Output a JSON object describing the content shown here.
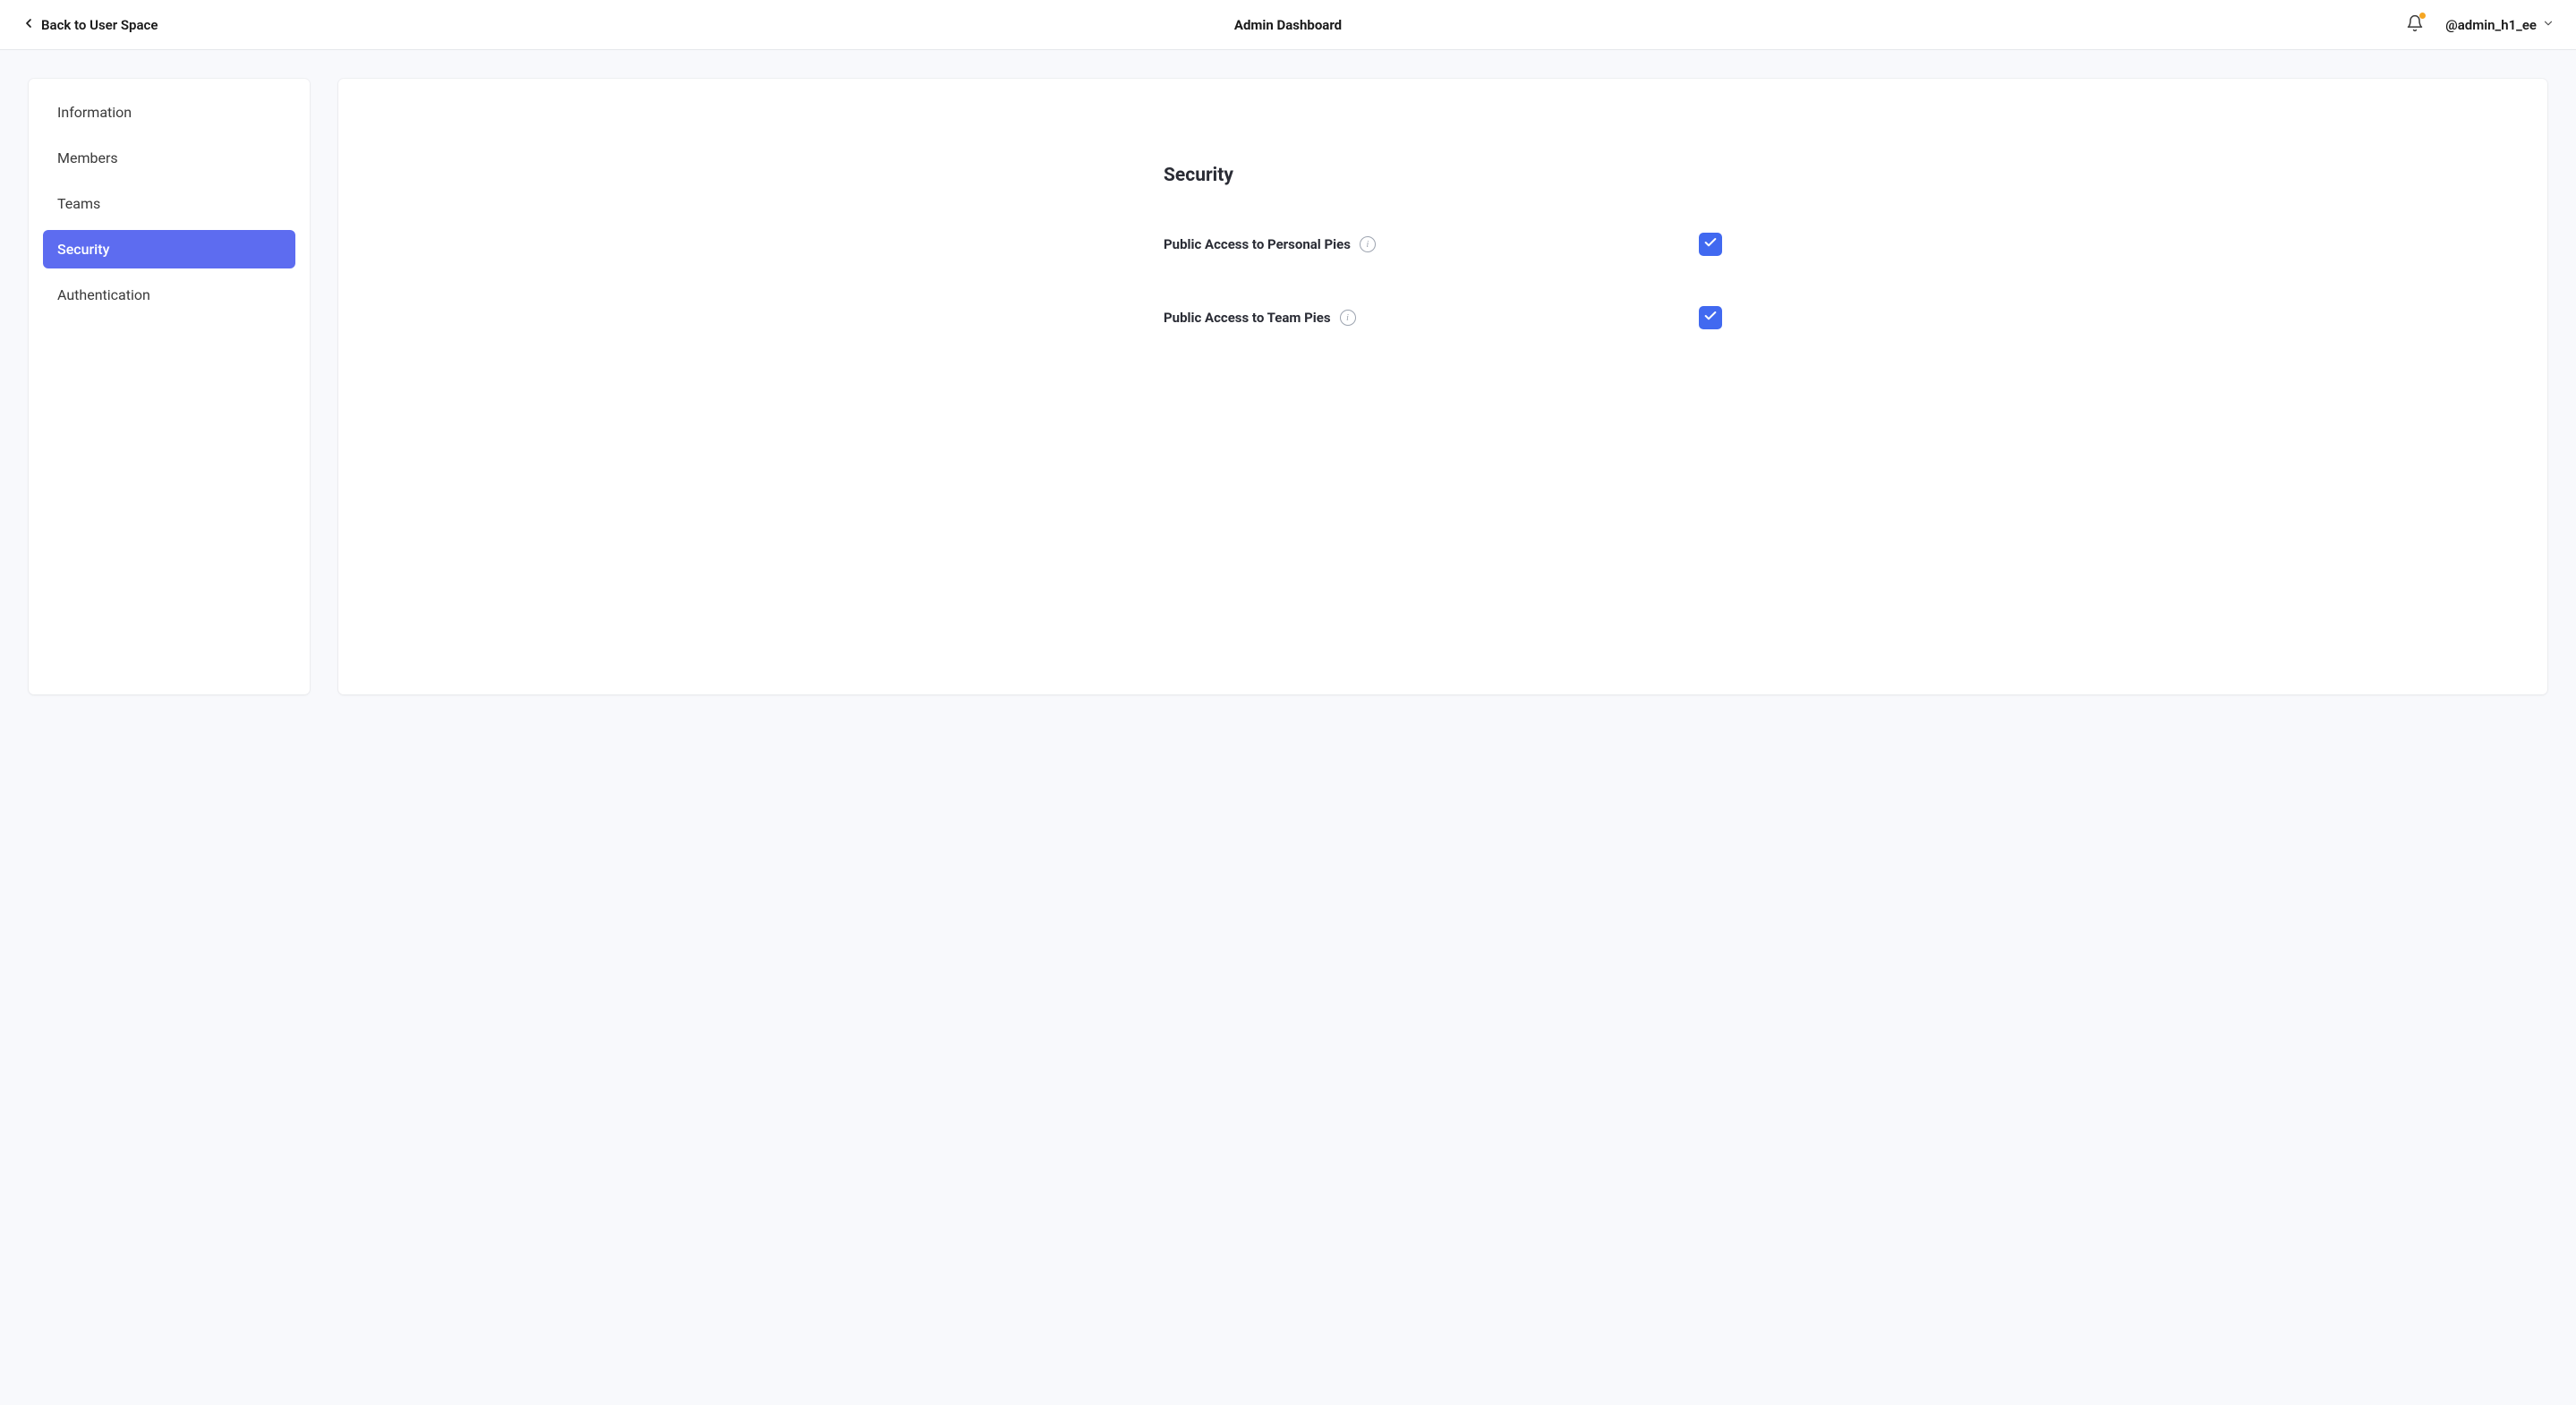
{
  "topbar": {
    "back_label": "Back to User Space",
    "title": "Admin Dashboard",
    "user_handle": "@admin_h1_ee"
  },
  "sidebar": {
    "items": [
      {
        "label": "Information",
        "active": false
      },
      {
        "label": "Members",
        "active": false
      },
      {
        "label": "Teams",
        "active": false
      },
      {
        "label": "Security",
        "active": true
      },
      {
        "label": "Authentication",
        "active": false
      }
    ]
  },
  "main": {
    "section_title": "Security",
    "settings": [
      {
        "label": "Public Access to Personal Pies",
        "checked": true
      },
      {
        "label": "Public Access to Team Pies",
        "checked": true
      }
    ]
  },
  "colors": {
    "sidebar_active": "#5d6cf0",
    "checkbox": "#4169f0",
    "notification_dot": "#f5a623"
  }
}
